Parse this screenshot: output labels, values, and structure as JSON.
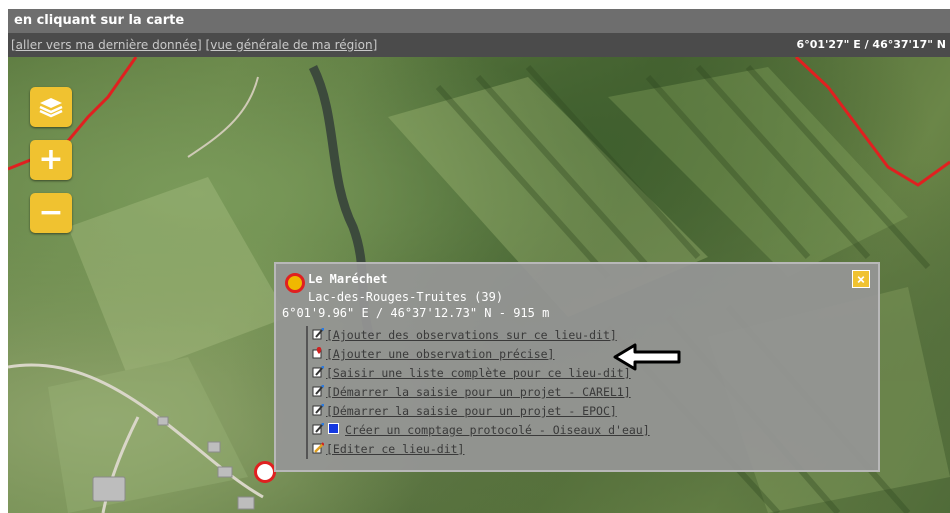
{
  "header": {
    "title": "en cliquant sur la carte"
  },
  "linkbar": {
    "link_last": "[aller vers ma dernière donnée]",
    "link_region": "[vue générale de ma région]",
    "coords": "6°01'27\" E / 46°37'17\" N"
  },
  "map_controls": {
    "zoom_in": "+",
    "zoom_out": "−"
  },
  "popup": {
    "close_label": "×",
    "place_name": "Le Maréchet",
    "commune": "Lac-des-Rouges-Truites (39)",
    "coords": "6°01'9.96\" E / 46°37'12.73\" N - 915 m",
    "actions": [
      "[Ajouter des observations sur ce lieu-dit]",
      "[Ajouter une observation précise]",
      "[Saisir une liste complète pour ce lieu-dit]",
      "[Démarrer la saisie pour un projet - CAREL1]",
      "[Démarrer la saisie pour un projet - EPOC]",
      "Créer un comptage protocolé - Oiseaux d'eau]",
      "[Editer ce lieu-dit]"
    ]
  },
  "colors": {
    "accent": "#f0c230",
    "border_red": "#e02020"
  }
}
